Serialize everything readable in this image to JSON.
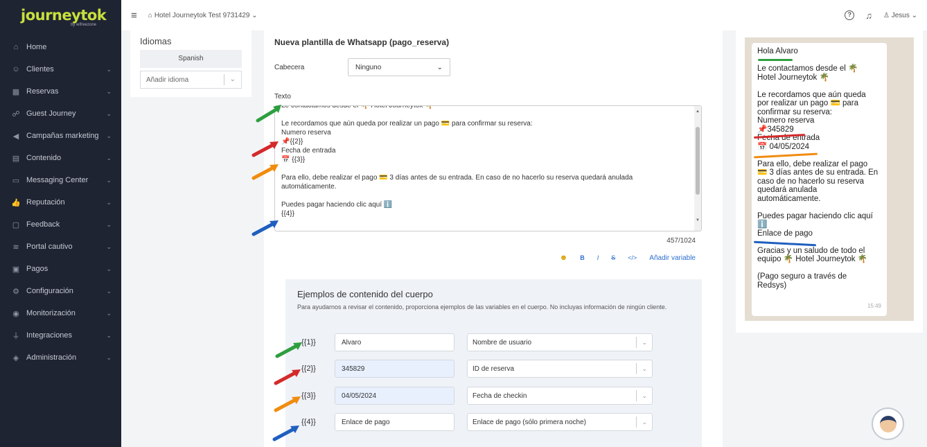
{
  "brand": {
    "name": "journeytok",
    "sub": "by wifreezone"
  },
  "sidebar": {
    "items": [
      {
        "label": "Home",
        "icon": "home-icon",
        "glyph": "⌂",
        "chev": false
      },
      {
        "label": "Clientes",
        "icon": "users-icon",
        "glyph": "☺",
        "chev": true
      },
      {
        "label": "Reservas",
        "icon": "calendar-icon",
        "glyph": "▦",
        "chev": true
      },
      {
        "label": "Guest Journey",
        "icon": "route-icon",
        "glyph": "☍",
        "chev": true
      },
      {
        "label": "Campañas marketing",
        "icon": "megaphone-icon",
        "glyph": "◀",
        "chev": true
      },
      {
        "label": "Contenido",
        "icon": "document-icon",
        "glyph": "▤",
        "chev": true
      },
      {
        "label": "Messaging Center",
        "icon": "message-icon",
        "glyph": "▭",
        "chev": true
      },
      {
        "label": "Reputación",
        "icon": "thumbs-up-icon",
        "glyph": "👍",
        "chev": true
      },
      {
        "label": "Feedback",
        "icon": "feedback-icon",
        "glyph": "▢",
        "chev": true
      },
      {
        "label": "Portal cautivo",
        "icon": "wifi-icon",
        "glyph": "≋",
        "chev": true
      },
      {
        "label": "Pagos",
        "icon": "payment-icon",
        "glyph": "▣",
        "chev": true
      },
      {
        "label": "Configuración",
        "icon": "gear-icon",
        "glyph": "⚙",
        "chev": true
      },
      {
        "label": "Monitorización",
        "icon": "eye-icon",
        "glyph": "◉",
        "chev": true
      },
      {
        "label": "Integraciones",
        "icon": "plug-icon",
        "glyph": "⏚",
        "chev": true
      },
      {
        "label": "Administración",
        "icon": "shield-icon",
        "glyph": "◈",
        "chev": true
      }
    ]
  },
  "topbar": {
    "hotel": "Hotel Journeytok Test 9731429",
    "user": "Jesus"
  },
  "languages": {
    "title": "Idiomas",
    "current": "Spanish",
    "add_placeholder": "Añadir idioma"
  },
  "form": {
    "title": "Nueva plantilla de Whatsapp (pago_reserva)",
    "header_label": "Cabecera",
    "header_value": "Ninguno",
    "text_label": "Texto",
    "text_lines": [
      "Le contactamos desde el 🌴 Hotel Journeytok 🌴",
      "",
      "Le recordamos que aún queda por realizar un pago 💳 para confirmar su reserva:",
      "Numero reserva",
      "📌{{2}}",
      "Fecha de entrada",
      "📅 {{3}}",
      "",
      "Para ello, debe realizar el pago 💳 3 días antes de su entrada. En caso de no hacerlo su reserva quedará anulada automáticamente.",
      "",
      "Puedes pagar haciendo clic aquí ℹ️",
      "{{4}}"
    ],
    "counter": "457/1024",
    "toolbar": {
      "emoji": "☻",
      "bold": "B",
      "italic": "I",
      "strike": "S",
      "code": "</>",
      "add_variable": "Añadir variable"
    }
  },
  "examples": {
    "title": "Ejemplos de contenido del cuerpo",
    "description": "Para ayudarnos a revisar el contenido, proporciona ejemplos de las variables en el cuerpo. No incluyas información de ningún cliente.",
    "rows": [
      {
        "var": "{{1}}",
        "value": "Alvaro",
        "type": "Nombre de usuario"
      },
      {
        "var": "{{2}}",
        "value": "345829",
        "type": "ID de reserva"
      },
      {
        "var": "{{3}}",
        "value": "04/05/2024",
        "type": "Fecha de checkin"
      },
      {
        "var": "{{4}}",
        "value": "Enlace de pago",
        "type": "Enlace de pago (sólo primera noche)"
      }
    ]
  },
  "preview": {
    "lines": [
      "Hola Alvaro",
      "",
      "Le contactamos desde el 🌴",
      "Hotel Journeytok 🌴",
      "",
      "Le recordamos que aún queda",
      "por realizar un pago 💳 para",
      "confirmar su reserva:",
      "Numero reserva",
      "📌345829",
      "Fecha de entrada",
      "📅 04/05/2024",
      "",
      "Para ello, debe realizar el pago",
      "💳 3 días antes de su entrada. En",
      "caso de no hacerlo su reserva",
      "quedará anulada",
      "automáticamente.",
      "",
      "Puedes pagar haciendo clic aquí",
      "ℹ️",
      "Enlace de pago",
      "",
      "Gracias y un saludo de todo el",
      "equipo 🌴 Hotel Journeytok 🌴",
      "",
      "(Pago seguro a través de",
      "Redsys)"
    ],
    "time": "15:49"
  },
  "colors": {
    "green": "#2e9e3f",
    "red": "#d42a2a",
    "orange": "#f08c10",
    "blue": "#1f5fbf",
    "sidebar": "#1f2433",
    "accent": "#c8e03c"
  }
}
